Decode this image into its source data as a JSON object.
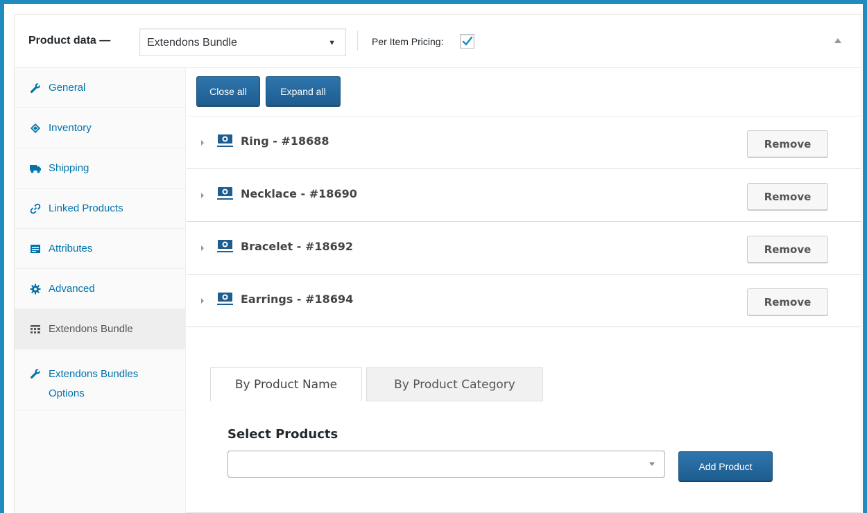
{
  "header": {
    "title": "Product data —",
    "product_type": "Extendons Bundle",
    "per_item_pricing_label": "Per Item Pricing:",
    "per_item_pricing_checked": true
  },
  "sidebar": {
    "items": [
      {
        "label": "General",
        "icon": "wrench-icon",
        "active": false
      },
      {
        "label": "Inventory",
        "icon": "tag-icon",
        "active": false
      },
      {
        "label": "Shipping",
        "icon": "truck-icon",
        "active": false
      },
      {
        "label": "Linked Products",
        "icon": "link-icon",
        "active": false
      },
      {
        "label": "Attributes",
        "icon": "list-icon",
        "active": false
      },
      {
        "label": "Advanced",
        "icon": "gear-icon",
        "active": false
      },
      {
        "label": "Extendons Bundle",
        "icon": "grid-icon",
        "active": true
      },
      {
        "label": "Extendons Bundles Options",
        "icon": "wrench-icon",
        "active": false
      }
    ]
  },
  "toolbar": {
    "close_all": "Close all",
    "expand_all": "Expand all"
  },
  "bundle_items": [
    {
      "title": "Ring - #18688",
      "remove_label": "Remove"
    },
    {
      "title": "Necklace - #18690",
      "remove_label": "Remove"
    },
    {
      "title": "Bracelet - #18692",
      "remove_label": "Remove"
    },
    {
      "title": "Earrings - #18694",
      "remove_label": "Remove"
    }
  ],
  "search": {
    "tabs": [
      "By Product Name",
      "By Product Category"
    ],
    "active_tab": "By Product Name",
    "select_label": "Select Products",
    "select_value": "",
    "add_button": "Add Product"
  },
  "colors": {
    "frame": "#1e8cbe",
    "link": "#0073aa",
    "primary_button": "#2271b1"
  }
}
